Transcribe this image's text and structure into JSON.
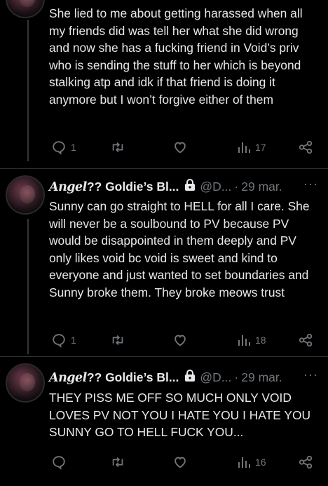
{
  "tweets": [
    {
      "text": "She lied to me about getting harassed when all my friends did was tell her what she did wrong and now she has a fucking friend in Void’s priv who is sending the stuff to her which is beyond stalking atp and idk if that friend is doing it anymore but I won’t forgive either of them",
      "replies": "1",
      "views": "17"
    },
    {
      "name_script": "Angel",
      "name_rest": "?? Goldie’s Bl...",
      "handle": "@D...",
      "separator": "·",
      "date": "29 mar.",
      "more": "···",
      "text": "Sunny can go straight to HELL for all I care. She will never be a soulbound to PV because PV would be disappointed in them deeply and PV only likes void bc void is sweet and kind to everyone and just wanted to set boundaries and Sunny broke them. They broke meows trust",
      "replies": "1",
      "views": "18"
    },
    {
      "name_script": "Angel",
      "name_rest": "?? Goldie’s Bl...",
      "handle": "@D...",
      "separator": "·",
      "date": "29 mar.",
      "more": "···",
      "text": "THEY PISS ME OFF SO MUCH ONLY VOID LOVES PV NOT YOU I HATE YOU I HATE YOU SUNNY GO TO HELL FUCK YOU...",
      "replies": "",
      "views": "16"
    }
  ],
  "icons": {
    "reply": "reply-icon",
    "retweet": "retweet-icon",
    "like": "heart-icon",
    "views": "views-icon",
    "share": "share-icon",
    "lock": "lock-icon"
  },
  "colors": {
    "background": "#000000",
    "text": "#e7e9ea",
    "muted": "#71767b",
    "divider": "#2f3336"
  }
}
